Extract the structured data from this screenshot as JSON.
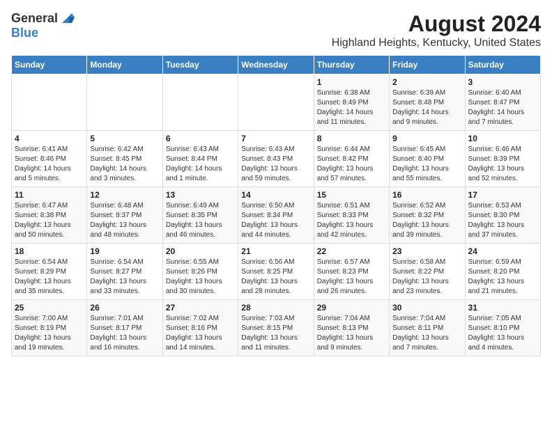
{
  "logo": {
    "general": "General",
    "blue": "Blue"
  },
  "title": "August 2024",
  "subtitle": "Highland Heights, Kentucky, United States",
  "weekdays": [
    "Sunday",
    "Monday",
    "Tuesday",
    "Wednesday",
    "Thursday",
    "Friday",
    "Saturday"
  ],
  "weeks": [
    [
      {
        "day": "",
        "info": ""
      },
      {
        "day": "",
        "info": ""
      },
      {
        "day": "",
        "info": ""
      },
      {
        "day": "",
        "info": ""
      },
      {
        "day": "1",
        "info": "Sunrise: 6:38 AM\nSunset: 8:49 PM\nDaylight: 14 hours\nand 11 minutes."
      },
      {
        "day": "2",
        "info": "Sunrise: 6:39 AM\nSunset: 8:48 PM\nDaylight: 14 hours\nand 9 minutes."
      },
      {
        "day": "3",
        "info": "Sunrise: 6:40 AM\nSunset: 8:47 PM\nDaylight: 14 hours\nand 7 minutes."
      }
    ],
    [
      {
        "day": "4",
        "info": "Sunrise: 6:41 AM\nSunset: 8:46 PM\nDaylight: 14 hours\nand 5 minutes."
      },
      {
        "day": "5",
        "info": "Sunrise: 6:42 AM\nSunset: 8:45 PM\nDaylight: 14 hours\nand 3 minutes."
      },
      {
        "day": "6",
        "info": "Sunrise: 6:43 AM\nSunset: 8:44 PM\nDaylight: 14 hours\nand 1 minute."
      },
      {
        "day": "7",
        "info": "Sunrise: 6:43 AM\nSunset: 8:43 PM\nDaylight: 13 hours\nand 59 minutes."
      },
      {
        "day": "8",
        "info": "Sunrise: 6:44 AM\nSunset: 8:42 PM\nDaylight: 13 hours\nand 57 minutes."
      },
      {
        "day": "9",
        "info": "Sunrise: 6:45 AM\nSunset: 8:40 PM\nDaylight: 13 hours\nand 55 minutes."
      },
      {
        "day": "10",
        "info": "Sunrise: 6:46 AM\nSunset: 8:39 PM\nDaylight: 13 hours\nand 52 minutes."
      }
    ],
    [
      {
        "day": "11",
        "info": "Sunrise: 6:47 AM\nSunset: 8:38 PM\nDaylight: 13 hours\nand 50 minutes."
      },
      {
        "day": "12",
        "info": "Sunrise: 6:48 AM\nSunset: 8:37 PM\nDaylight: 13 hours\nand 48 minutes."
      },
      {
        "day": "13",
        "info": "Sunrise: 6:49 AM\nSunset: 8:35 PM\nDaylight: 13 hours\nand 46 minutes."
      },
      {
        "day": "14",
        "info": "Sunrise: 6:50 AM\nSunset: 8:34 PM\nDaylight: 13 hours\nand 44 minutes."
      },
      {
        "day": "15",
        "info": "Sunrise: 6:51 AM\nSunset: 8:33 PM\nDaylight: 13 hours\nand 42 minutes."
      },
      {
        "day": "16",
        "info": "Sunrise: 6:52 AM\nSunset: 8:32 PM\nDaylight: 13 hours\nand 39 minutes."
      },
      {
        "day": "17",
        "info": "Sunrise: 6:53 AM\nSunset: 8:30 PM\nDaylight: 13 hours\nand 37 minutes."
      }
    ],
    [
      {
        "day": "18",
        "info": "Sunrise: 6:54 AM\nSunset: 8:29 PM\nDaylight: 13 hours\nand 35 minutes."
      },
      {
        "day": "19",
        "info": "Sunrise: 6:54 AM\nSunset: 8:27 PM\nDaylight: 13 hours\nand 33 minutes."
      },
      {
        "day": "20",
        "info": "Sunrise: 6:55 AM\nSunset: 8:26 PM\nDaylight: 13 hours\nand 30 minutes."
      },
      {
        "day": "21",
        "info": "Sunrise: 6:56 AM\nSunset: 8:25 PM\nDaylight: 13 hours\nand 28 minutes."
      },
      {
        "day": "22",
        "info": "Sunrise: 6:57 AM\nSunset: 8:23 PM\nDaylight: 13 hours\nand 26 minutes."
      },
      {
        "day": "23",
        "info": "Sunrise: 6:58 AM\nSunset: 8:22 PM\nDaylight: 13 hours\nand 23 minutes."
      },
      {
        "day": "24",
        "info": "Sunrise: 6:59 AM\nSunset: 8:20 PM\nDaylight: 13 hours\nand 21 minutes."
      }
    ],
    [
      {
        "day": "25",
        "info": "Sunrise: 7:00 AM\nSunset: 8:19 PM\nDaylight: 13 hours\nand 19 minutes."
      },
      {
        "day": "26",
        "info": "Sunrise: 7:01 AM\nSunset: 8:17 PM\nDaylight: 13 hours\nand 16 minutes."
      },
      {
        "day": "27",
        "info": "Sunrise: 7:02 AM\nSunset: 8:16 PM\nDaylight: 13 hours\nand 14 minutes."
      },
      {
        "day": "28",
        "info": "Sunrise: 7:03 AM\nSunset: 8:15 PM\nDaylight: 13 hours\nand 11 minutes."
      },
      {
        "day": "29",
        "info": "Sunrise: 7:04 AM\nSunset: 8:13 PM\nDaylight: 13 hours\nand 9 minutes."
      },
      {
        "day": "30",
        "info": "Sunrise: 7:04 AM\nSunset: 8:11 PM\nDaylight: 13 hours\nand 7 minutes."
      },
      {
        "day": "31",
        "info": "Sunrise: 7:05 AM\nSunset: 8:10 PM\nDaylight: 13 hours\nand 4 minutes."
      }
    ]
  ]
}
